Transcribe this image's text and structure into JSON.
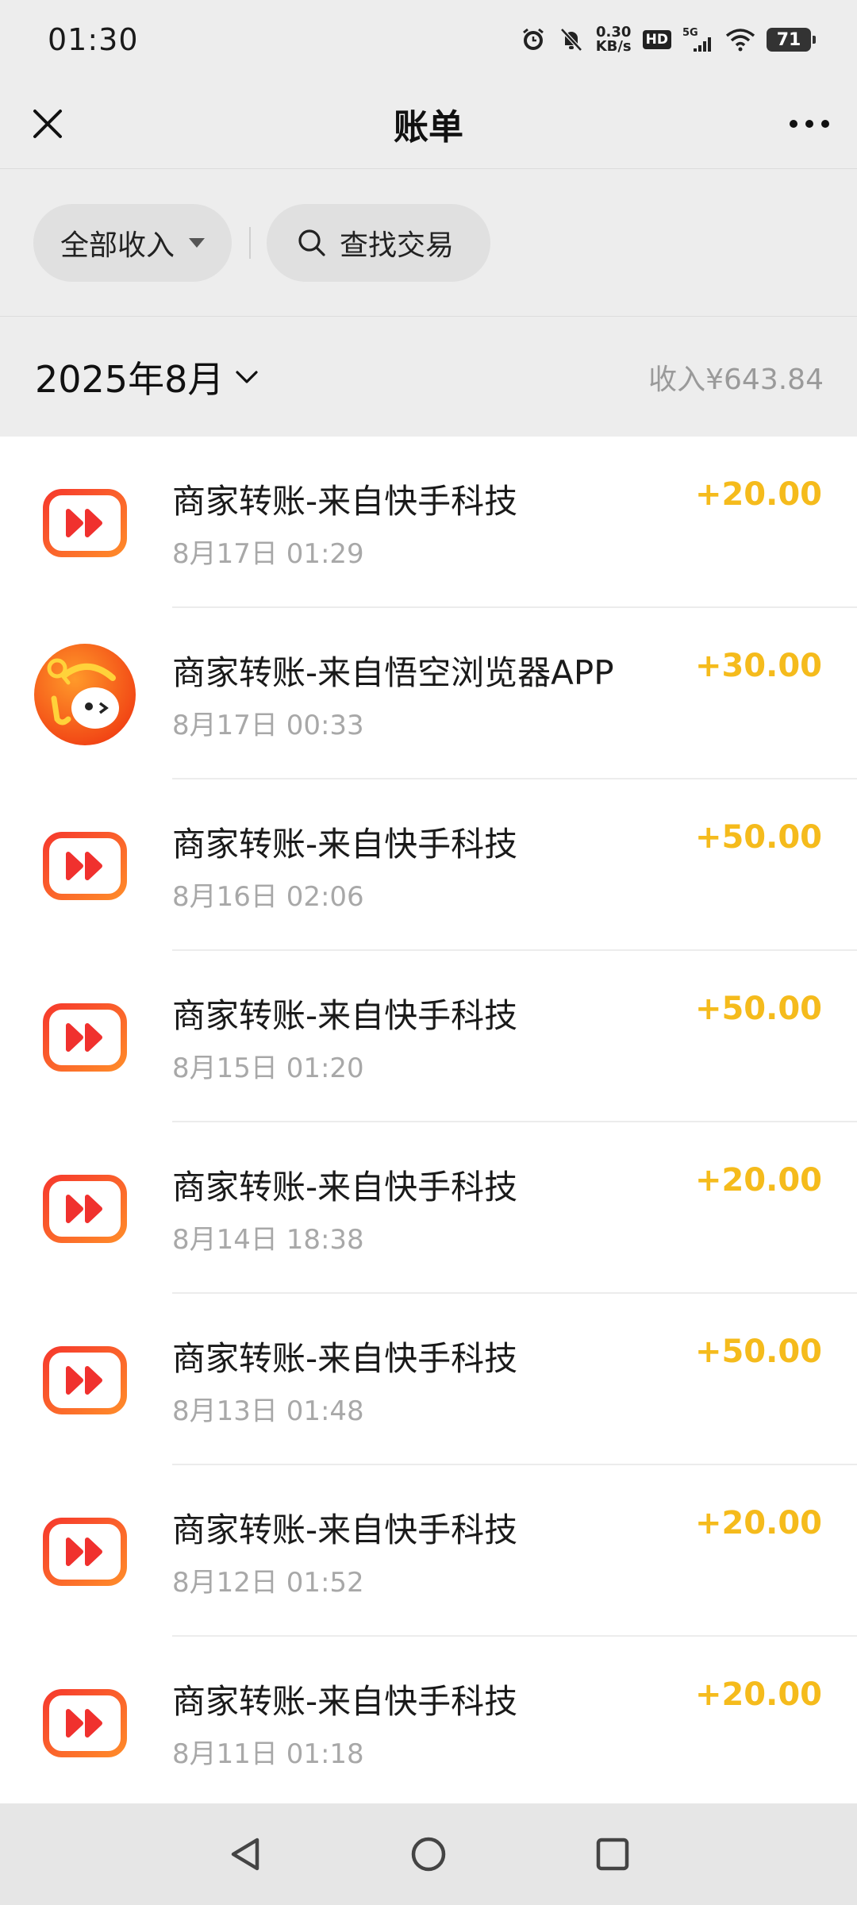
{
  "status_bar": {
    "time": "01:30",
    "net_speed_value": "0.30",
    "net_speed_unit": "KB/s",
    "hd": "HD",
    "signal": "5G",
    "battery": "71",
    "icons": [
      "alarm-icon",
      "mute-bell-icon",
      "signal-icon",
      "wifi-icon",
      "battery-icon"
    ]
  },
  "header": {
    "title": "账单",
    "close_icon": "close-icon",
    "more_icon": "more-icon"
  },
  "filters": {
    "type_filter": "全部收入",
    "search_label": "查找交易"
  },
  "month_bar": {
    "month": "2025年8月",
    "income_summary": "收入¥643.84"
  },
  "transactions": [
    {
      "title": "商家转账-来自快手科技",
      "time": "8月17日 01:29",
      "amount": "+20.00",
      "icon": "kuaishou-icon"
    },
    {
      "title": "商家转账-来自悟空浏览器APP",
      "time": "8月17日 00:33",
      "amount": "+30.00",
      "icon": "wukong-browser-icon"
    },
    {
      "title": "商家转账-来自快手科技",
      "time": "8月16日 02:06",
      "amount": "+50.00",
      "icon": "kuaishou-icon"
    },
    {
      "title": "商家转账-来自快手科技",
      "time": "8月15日 01:20",
      "amount": "+50.00",
      "icon": "kuaishou-icon"
    },
    {
      "title": "商家转账-来自快手科技",
      "time": "8月14日 18:38",
      "amount": "+20.00",
      "icon": "kuaishou-icon"
    },
    {
      "title": "商家转账-来自快手科技",
      "time": "8月13日 01:48",
      "amount": "+50.00",
      "icon": "kuaishou-icon"
    },
    {
      "title": "商家转账-来自快手科技",
      "time": "8月12日 01:52",
      "amount": "+20.00",
      "icon": "kuaishou-icon"
    },
    {
      "title": "商家转账-来自快手科技",
      "time": "8月11日 01:18",
      "amount": "+20.00",
      "icon": "kuaishou-icon"
    }
  ],
  "colors": {
    "amount": "#f5bb1c",
    "background": "#ededed",
    "list_background": "#ffffff",
    "kuaishou_red": "#f0312e",
    "kuaishou_orange": "#ff7a1a"
  },
  "nav_bar": {
    "icons": [
      "back-icon",
      "home-icon",
      "recents-icon"
    ]
  }
}
